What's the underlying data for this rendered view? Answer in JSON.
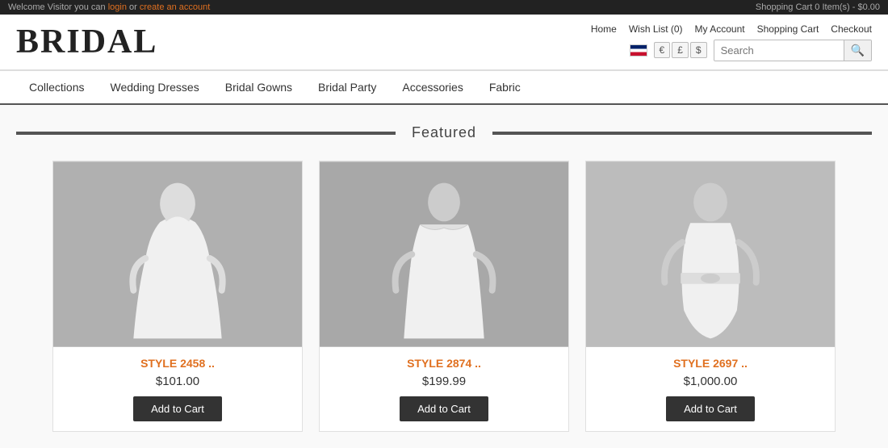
{
  "topbar": {
    "welcome_text": "Welcome Visitor you can ",
    "login_label": "login",
    "or_text": " or ",
    "create_account_label": "create an account",
    "cart_label": "Shopping Cart  0 Item(s) - $0.00",
    "nav_links": [
      "Home",
      "Wish List (0)",
      "My Account",
      "Shopping Cart",
      "Checkout"
    ]
  },
  "header": {
    "logo": "BRIDAL"
  },
  "currency": {
    "euro": "€",
    "pound": "£",
    "dollar": "$"
  },
  "search": {
    "placeholder": "Search",
    "icon": "🔍"
  },
  "nav": {
    "items": [
      {
        "label": "Collections"
      },
      {
        "label": "Wedding Dresses"
      },
      {
        "label": "Bridal Gowns"
      },
      {
        "label": "Bridal Party"
      },
      {
        "label": "Accessories"
      },
      {
        "label": "Fabric"
      }
    ]
  },
  "featured": {
    "title": "Featured"
  },
  "products": [
    {
      "style": "STYLE 2458 ..",
      "price": "$101.00",
      "add_to_cart": "Add to Cart"
    },
    {
      "style": "STYLE 2874 ..",
      "price": "$199.99",
      "add_to_cart": "Add to Cart"
    },
    {
      "style": "STYLE 2697 ..",
      "price": "$1,000.00",
      "add_to_cart": "Add to Cart"
    }
  ]
}
